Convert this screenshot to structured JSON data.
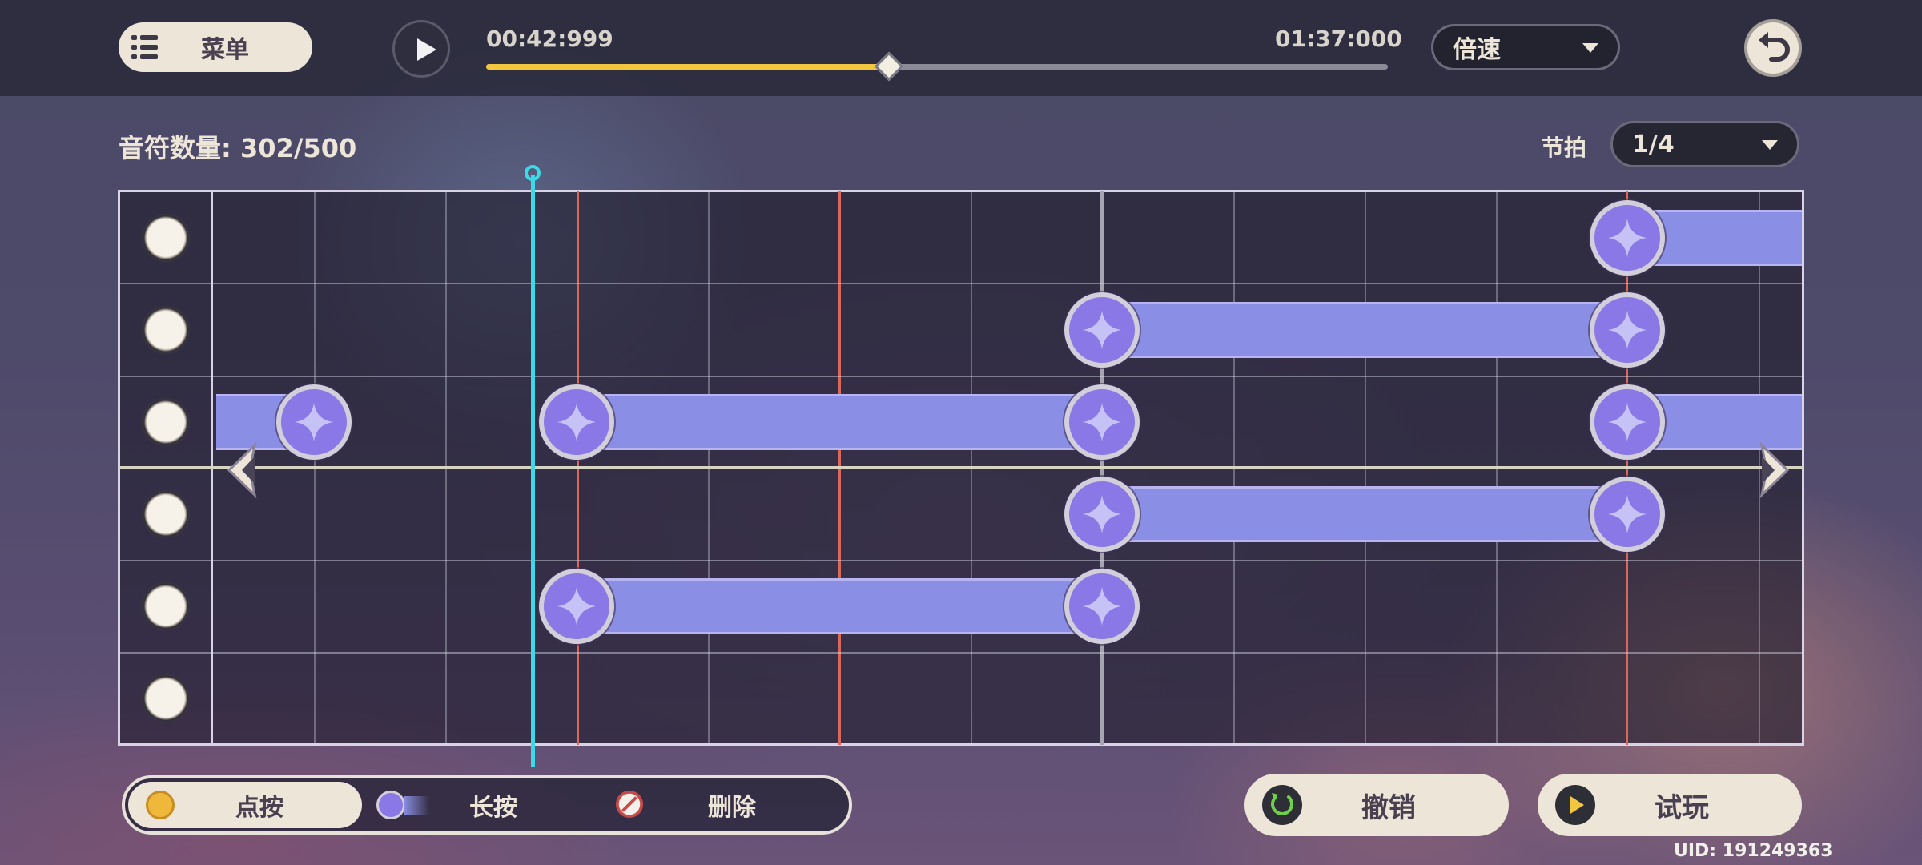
{
  "topbar": {
    "menu_label": "菜单",
    "time_current": "00:42:999",
    "time_total": "01:37:000",
    "progress": 0.447,
    "speed_label": "倍速"
  },
  "editor": {
    "note_count_label": "音符数量: 302/500",
    "beat_label": "节拍",
    "beat_value": "1/4"
  },
  "tools": {
    "tap_label": "点按",
    "hold_label": "长按",
    "delete_label": "删除",
    "selected": "点按"
  },
  "actions": {
    "undo_label": "撤销",
    "try_label": "试玩"
  },
  "footer": {
    "uid": "UID: 191249363"
  },
  "colors": {
    "accent_yellow": "#f3c640",
    "note_purple": "#8a78e6",
    "playhead_cyan": "#3dd9e6",
    "beat_red": "#d9685a",
    "panel_cream": "#ece5d8"
  },
  "icons": {
    "menu": "list-icon",
    "play": "play-icon",
    "back": "back-arrow-icon",
    "undo": "undo-icon",
    "try": "play-icon",
    "tap_tool": "tap-note-icon",
    "hold_tool": "hold-note-icon",
    "delete_tool": "no-entry-icon",
    "note": "four-point-star-icon"
  }
}
